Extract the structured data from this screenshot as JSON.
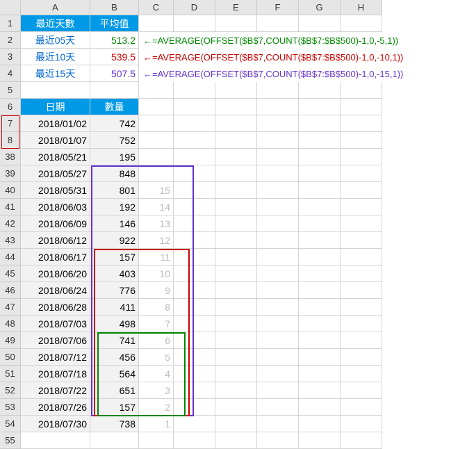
{
  "columns": [
    "A",
    "B",
    "C",
    "D",
    "E",
    "F",
    "G",
    "H"
  ],
  "header1": {
    "a": "最近天數",
    "b": "平均值"
  },
  "avgRows": [
    {
      "r": "2",
      "label": "最近05天",
      "val": "513.2",
      "arrow": "←",
      "formula": "=AVERAGE(OFFSET($B$7,COUNT($B$7:$B$500)-1,0,-5,1))",
      "cls": "G",
      "color": "#008800"
    },
    {
      "r": "3",
      "label": "最近10天",
      "val": "539.5",
      "arrow": "←",
      "formula": "=AVERAGE(OFFSET($B$7,COUNT($B$7:$B$500)-1,0,-10,1))",
      "cls": "R",
      "color": "#cc0000"
    },
    {
      "r": "4",
      "label": "最近15天",
      "val": "507.5",
      "arrow": "←",
      "formula": "=AVERAGE(OFFSET($B$7,COUNT($B$7:$B$500)-1,0,-15,1))",
      "cls": "P",
      "color": "#6633cc"
    }
  ],
  "header2": {
    "a": "日期",
    "b": "數量"
  },
  "dataRows": [
    {
      "r": "7",
      "date": "2018/01/02",
      "qty": "742",
      "cnt": ""
    },
    {
      "r": "8",
      "date": "2018/01/07",
      "qty": "752",
      "cnt": ""
    },
    {
      "r": "38",
      "date": "2018/05/21",
      "qty": "195",
      "cnt": ""
    },
    {
      "r": "39",
      "date": "2018/05/27",
      "qty": "848",
      "cnt": ""
    },
    {
      "r": "40",
      "date": "2018/05/31",
      "qty": "801",
      "cnt": "15"
    },
    {
      "r": "41",
      "date": "2018/06/03",
      "qty": "192",
      "cnt": "14"
    },
    {
      "r": "42",
      "date": "2018/06/09",
      "qty": "146",
      "cnt": "13"
    },
    {
      "r": "43",
      "date": "2018/06/12",
      "qty": "922",
      "cnt": "12"
    },
    {
      "r": "44",
      "date": "2018/06/17",
      "qty": "157",
      "cnt": "11"
    },
    {
      "r": "45",
      "date": "2018/06/20",
      "qty": "403",
      "cnt": "10"
    },
    {
      "r": "46",
      "date": "2018/06/24",
      "qty": "776",
      "cnt": "9"
    },
    {
      "r": "47",
      "date": "2018/06/28",
      "qty": "411",
      "cnt": "8"
    },
    {
      "r": "48",
      "date": "2018/07/03",
      "qty": "498",
      "cnt": "7"
    },
    {
      "r": "49",
      "date": "2018/07/06",
      "qty": "741",
      "cnt": "6"
    },
    {
      "r": "50",
      "date": "2018/07/12",
      "qty": "456",
      "cnt": "5"
    },
    {
      "r": "51",
      "date": "2018/07/18",
      "qty": "564",
      "cnt": "4"
    },
    {
      "r": "52",
      "date": "2018/07/22",
      "qty": "651",
      "cnt": "3"
    },
    {
      "r": "53",
      "date": "2018/07/26",
      "qty": "157",
      "cnt": "2"
    },
    {
      "r": "54",
      "date": "2018/07/30",
      "qty": "738",
      "cnt": "1"
    }
  ],
  "emptyRows": [
    "5",
    "55"
  ],
  "boxes": {
    "purple": {
      "color": "#6633cc"
    },
    "red": {
      "color": "#cc0000"
    },
    "green": {
      "color": "#008800"
    }
  }
}
